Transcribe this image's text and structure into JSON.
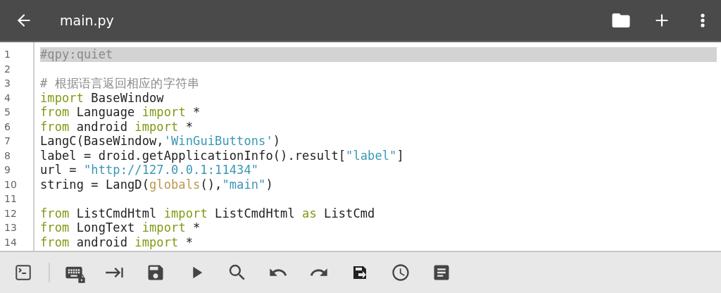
{
  "app_bar": {
    "title": "main.py"
  },
  "editor": {
    "lines": [
      {
        "number": "1",
        "current": true,
        "tokens": [
          {
            "kind": "comment",
            "text": "#qpy:quiet"
          }
        ]
      },
      {
        "number": "2",
        "current": false
      },
      {
        "number": "3",
        "current": false,
        "tokens": [
          {
            "kind": "comment",
            "text": "# 根据语言返回相应的字符串"
          }
        ]
      },
      {
        "number": "4",
        "current": false,
        "tokens": [
          {
            "kind": "keyword",
            "text": "import"
          },
          {
            "kind": "plain",
            "text": " BaseWindow"
          }
        ]
      },
      {
        "number": "5",
        "current": false,
        "tokens": [
          {
            "kind": "keyword",
            "text": "from"
          },
          {
            "kind": "plain",
            "text": " Language "
          },
          {
            "kind": "keyword",
            "text": "import"
          },
          {
            "kind": "plain",
            "text": " *"
          }
        ]
      },
      {
        "number": "6",
        "current": false,
        "tokens": [
          {
            "kind": "keyword",
            "text": "from"
          },
          {
            "kind": "plain",
            "text": " android "
          },
          {
            "kind": "keyword",
            "text": "import"
          },
          {
            "kind": "plain",
            "text": " *"
          }
        ]
      },
      {
        "number": "7",
        "current": false,
        "tokens": [
          {
            "kind": "plain",
            "text": "LangC(BaseWindow,"
          },
          {
            "kind": "string",
            "text": "'WinGuiButtons'"
          },
          {
            "kind": "plain",
            "text": ")"
          }
        ]
      },
      {
        "number": "8",
        "current": false,
        "tokens": [
          {
            "kind": "plain",
            "text": "label = droid.getApplicationInfo().result["
          },
          {
            "kind": "string",
            "text": "\"label\""
          },
          {
            "kind": "plain",
            "text": "]"
          }
        ]
      },
      {
        "number": "9",
        "current": false,
        "tokens": [
          {
            "kind": "plain",
            "text": "url = "
          },
          {
            "kind": "string",
            "text": "\"http://127.0.0.1:11434\""
          }
        ]
      },
      {
        "number": "10",
        "current": false,
        "tokens": [
          {
            "kind": "plain",
            "text": "string = LangD("
          },
          {
            "kind": "builtin",
            "text": "globals"
          },
          {
            "kind": "plain",
            "text": "(),"
          },
          {
            "kind": "string",
            "text": "\"main\""
          },
          {
            "kind": "plain",
            "text": ")"
          }
        ]
      },
      {
        "number": "11",
        "current": false
      },
      {
        "number": "12",
        "current": false,
        "tokens": [
          {
            "kind": "keyword",
            "text": "from"
          },
          {
            "kind": "plain",
            "text": " ListCmdHtml "
          },
          {
            "kind": "keyword",
            "text": "import"
          },
          {
            "kind": "plain",
            "text": " ListCmdHtml "
          },
          {
            "kind": "keyword",
            "text": "as"
          },
          {
            "kind": "plain",
            "text": " ListCmd"
          }
        ]
      },
      {
        "number": "13",
        "current": false,
        "tokens": [
          {
            "kind": "keyword",
            "text": "from"
          },
          {
            "kind": "plain",
            "text": " LongText "
          },
          {
            "kind": "keyword",
            "text": "import"
          },
          {
            "kind": "plain",
            "text": " *"
          }
        ]
      },
      {
        "number": "14",
        "current": false,
        "tokens": [
          {
            "kind": "keyword",
            "text": "from"
          },
          {
            "kind": "plain",
            "text": " android "
          },
          {
            "kind": "keyword",
            "text": "import"
          },
          {
            "kind": "plain",
            "text": " *"
          }
        ]
      }
    ]
  }
}
